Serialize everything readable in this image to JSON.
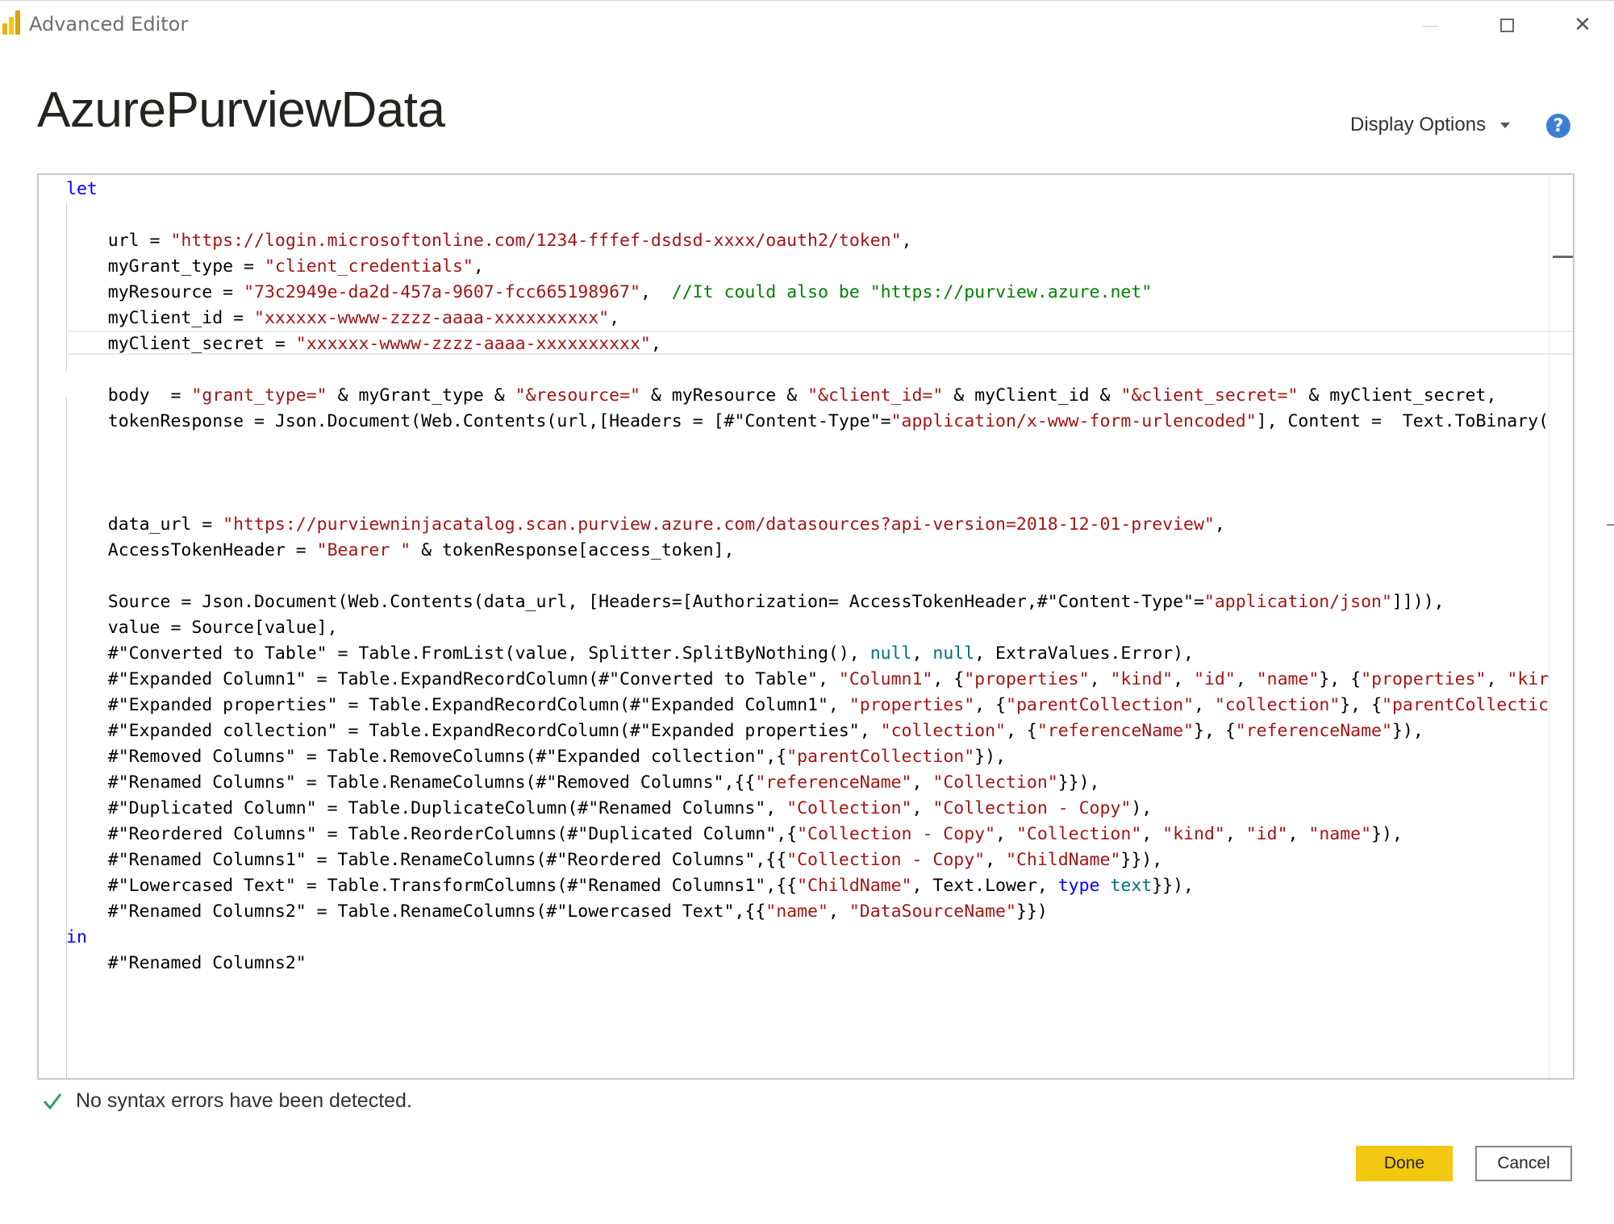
{
  "window": {
    "title": "Advanced Editor",
    "controls": {
      "minimize": "",
      "maximize": "",
      "close": "✕"
    }
  },
  "header": {
    "query_name": "AzurePurviewData",
    "display_options_label": "Display Options",
    "help_label": "?"
  },
  "editor": {
    "lines": [
      [
        {
          "k": "kw",
          "t": "let"
        }
      ],
      [],
      [
        {
          "t": "    url = "
        },
        {
          "k": "str",
          "t": "\"https://login.microsoftonline.com/1234-fffef-dsdsd-xxxx/oauth2/token\""
        },
        {
          "t": ","
        }
      ],
      [
        {
          "t": "    myGrant_type = "
        },
        {
          "k": "str",
          "t": "\"client_credentials\""
        },
        {
          "t": ","
        }
      ],
      [
        {
          "t": "    myResource = "
        },
        {
          "k": "str",
          "t": "\"73c2949e-da2d-457a-9607-fcc665198967\""
        },
        {
          "t": ",  "
        },
        {
          "k": "cmt",
          "t": "//It could also be \"https://purview.azure.net\""
        }
      ],
      [
        {
          "t": "    myClient_id = "
        },
        {
          "k": "str",
          "t": "\"xxxxxx-wwww-zzzz-aaaa-xxxxxxxxxx\""
        },
        {
          "t": ","
        }
      ],
      [
        {
          "t": "    myClient_secret = "
        },
        {
          "k": "str",
          "t": "\"xxxxxx-wwww-zzzz-aaaa-xxxxxxxxxx\""
        },
        {
          "t": ","
        }
      ],
      [],
      [
        {
          "t": "    body  = "
        },
        {
          "k": "str",
          "t": "\"grant_type=\""
        },
        {
          "t": " & myGrant_type & "
        },
        {
          "k": "str",
          "t": "\"&resource=\""
        },
        {
          "t": " & myResource & "
        },
        {
          "k": "str",
          "t": "\"&client_id=\""
        },
        {
          "t": " & myClient_id & "
        },
        {
          "k": "str",
          "t": "\"&client_secret=\""
        },
        {
          "t": " & myClient_secret,"
        }
      ],
      [
        {
          "t": "    tokenResponse = Json.Document(Web.Contents(url,[Headers = [#\"Content-Type\"="
        },
        {
          "k": "str",
          "t": "\"application/x-www-form-urlencoded\""
        },
        {
          "t": "], Content =  Text.ToBinary("
        }
      ],
      [],
      [],
      [],
      [
        {
          "t": "    data_url = "
        },
        {
          "k": "str",
          "t": "\"https://purviewninjacatalog.scan.purview.azure.com/datasources?api-version=2018-12-01-preview\""
        },
        {
          "t": ","
        }
      ],
      [
        {
          "t": "    AccessTokenHeader = "
        },
        {
          "k": "str",
          "t": "\"Bearer \""
        },
        {
          "t": " & tokenResponse[access_token],"
        }
      ],
      [],
      [
        {
          "t": "    Source = Json.Document(Web.Contents(data_url, [Headers=[Authorization= AccessTokenHeader,#\"Content-Type\"="
        },
        {
          "k": "str",
          "t": "\"application/json\""
        },
        {
          "t": "]])),"
        }
      ],
      [
        {
          "t": "    value = Source[value],"
        }
      ],
      [
        {
          "t": "    #\"Converted to Table\" = Table.FromList(value, Splitter.SplitByNothing(), "
        },
        {
          "k": "typ",
          "t": "null"
        },
        {
          "t": ", "
        },
        {
          "k": "typ",
          "t": "null"
        },
        {
          "t": ", ExtraValues.Error),"
        }
      ],
      [
        {
          "t": "    #\"Expanded Column1\" = Table.ExpandRecordColumn(#\"Converted to Table\", "
        },
        {
          "k": "str",
          "t": "\"Column1\""
        },
        {
          "t": ", {"
        },
        {
          "k": "str",
          "t": "\"properties\""
        },
        {
          "t": ", "
        },
        {
          "k": "str",
          "t": "\"kind\""
        },
        {
          "t": ", "
        },
        {
          "k": "str",
          "t": "\"id\""
        },
        {
          "t": ", "
        },
        {
          "k": "str",
          "t": "\"name\""
        },
        {
          "t": "}, {"
        },
        {
          "k": "str",
          "t": "\"properties\""
        },
        {
          "t": ", "
        },
        {
          "k": "str",
          "t": "\"kir"
        }
      ],
      [
        {
          "t": "    #\"Expanded properties\" = Table.ExpandRecordColumn(#\"Expanded Column1\", "
        },
        {
          "k": "str",
          "t": "\"properties\""
        },
        {
          "t": ", {"
        },
        {
          "k": "str",
          "t": "\"parentCollection\""
        },
        {
          "t": ", "
        },
        {
          "k": "str",
          "t": "\"collection\""
        },
        {
          "t": "}, {"
        },
        {
          "k": "str",
          "t": "\"parentCollectic"
        }
      ],
      [
        {
          "t": "    #\"Expanded collection\" = Table.ExpandRecordColumn(#\"Expanded properties\", "
        },
        {
          "k": "str",
          "t": "\"collection\""
        },
        {
          "t": ", {"
        },
        {
          "k": "str",
          "t": "\"referenceName\""
        },
        {
          "t": "}, {"
        },
        {
          "k": "str",
          "t": "\"referenceName\""
        },
        {
          "t": "}),"
        }
      ],
      [
        {
          "t": "    #\"Removed Columns\" = Table.RemoveColumns(#\"Expanded collection\",{"
        },
        {
          "k": "str",
          "t": "\"parentCollection\""
        },
        {
          "t": "}),"
        }
      ],
      [
        {
          "t": "    #\"Renamed Columns\" = Table.RenameColumns(#\"Removed Columns\",{{"
        },
        {
          "k": "str",
          "t": "\"referenceName\""
        },
        {
          "t": ", "
        },
        {
          "k": "str",
          "t": "\"Collection\""
        },
        {
          "t": "}}),"
        }
      ],
      [
        {
          "t": "    #\"Duplicated Column\" = Table.DuplicateColumn(#\"Renamed Columns\", "
        },
        {
          "k": "str",
          "t": "\"Collection\""
        },
        {
          "t": ", "
        },
        {
          "k": "str",
          "t": "\"Collection - Copy\""
        },
        {
          "t": "),"
        }
      ],
      [
        {
          "t": "    #\"Reordered Columns\" = Table.ReorderColumns(#\"Duplicated Column\",{"
        },
        {
          "k": "str",
          "t": "\"Collection - Copy\""
        },
        {
          "t": ", "
        },
        {
          "k": "str",
          "t": "\"Collection\""
        },
        {
          "t": ", "
        },
        {
          "k": "str",
          "t": "\"kind\""
        },
        {
          "t": ", "
        },
        {
          "k": "str",
          "t": "\"id\""
        },
        {
          "t": ", "
        },
        {
          "k": "str",
          "t": "\"name\""
        },
        {
          "t": "}),"
        }
      ],
      [
        {
          "t": "    #\"Renamed Columns1\" = Table.RenameColumns(#\"Reordered Columns\",{{"
        },
        {
          "k": "str",
          "t": "\"Collection - Copy\""
        },
        {
          "t": ", "
        },
        {
          "k": "str",
          "t": "\"ChildName\""
        },
        {
          "t": "}}),"
        }
      ],
      [
        {
          "t": "    #\"Lowercased Text\" = Table.TransformColumns(#\"Renamed Columns1\",{{"
        },
        {
          "k": "str",
          "t": "\"ChildName\""
        },
        {
          "t": ", Text.Lower, "
        },
        {
          "k": "kw",
          "t": "type"
        },
        {
          "t": " "
        },
        {
          "k": "typ",
          "t": "text"
        },
        {
          "t": "}}),"
        }
      ],
      [
        {
          "t": "    #\"Renamed Columns2\" = Table.RenameColumns(#\"Lowercased Text\",{{"
        },
        {
          "k": "str",
          "t": "\"name\""
        },
        {
          "t": ", "
        },
        {
          "k": "str",
          "t": "\"DataSourceName\""
        },
        {
          "t": "}})"
        }
      ],
      [
        {
          "k": "kw",
          "t": "in"
        }
      ],
      [
        {
          "t": "    #\"Renamed Columns2\""
        }
      ]
    ]
  },
  "status": {
    "message": "No syntax errors have been detected."
  },
  "buttons": {
    "done": "Done",
    "cancel": "Cancel"
  },
  "colors": {
    "accent": "#f2c811",
    "keyword": "#0000ff",
    "string": "#a31515",
    "comment": "#008000",
    "constant": "#006f8a",
    "success": "#3c9a5f"
  }
}
